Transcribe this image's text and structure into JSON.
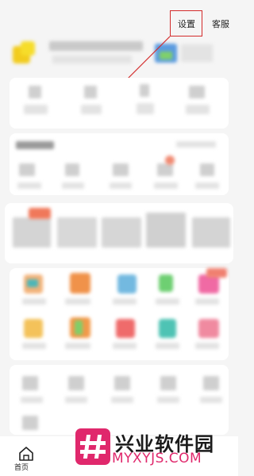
{
  "header": {
    "settings_label": "设置",
    "service_label": "客服"
  },
  "bottom_nav": {
    "home_label": "首页"
  },
  "watermark": {
    "brand": "兴业软件园",
    "url": "MYXYJS.COM"
  },
  "colors": {
    "annotation_red": "#d32b2b",
    "watermark_pink": "#e0286c"
  }
}
